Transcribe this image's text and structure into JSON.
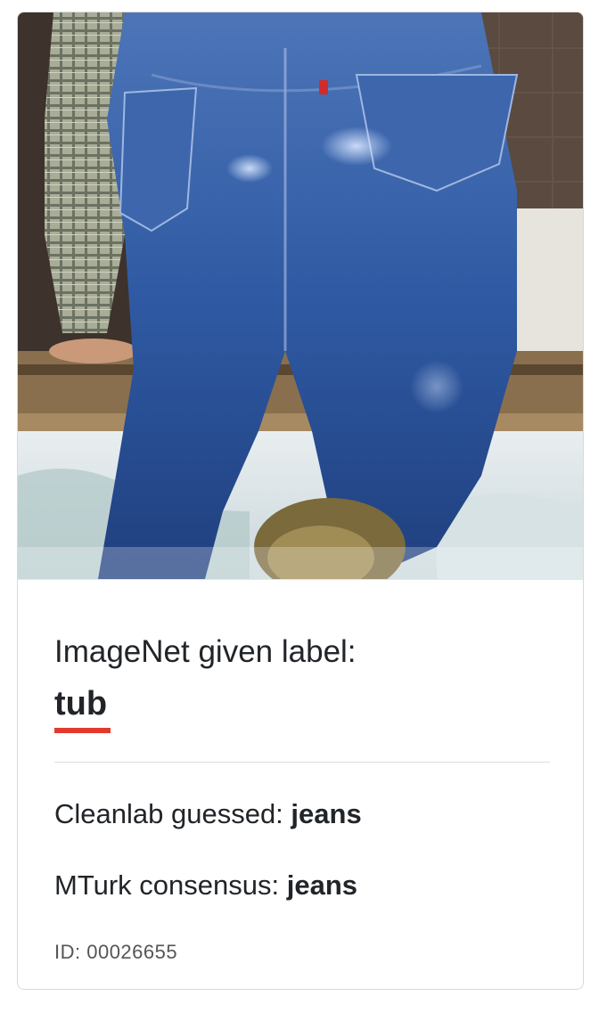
{
  "card": {
    "given_label_prefix": "ImageNet given label:",
    "given_label_value": "tub",
    "cleanlab_prefix": "Cleanlab guessed: ",
    "cleanlab_value": "jeans",
    "mturk_prefix": "MTurk consensus: ",
    "mturk_value": "jeans",
    "id_text": "ID: 00026655"
  },
  "colors": {
    "accent_underline": "#e23b2e",
    "text": "#212529",
    "muted": "#555555"
  }
}
